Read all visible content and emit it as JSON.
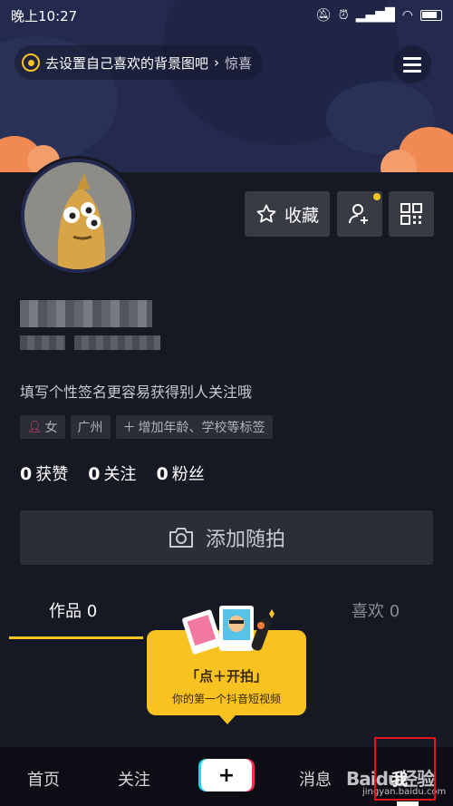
{
  "status_bar": {
    "time": "晚上10:27"
  },
  "header": {
    "background_prompt": "去设置自己喜欢的背景图吧",
    "prompt_trailing": "惊喜"
  },
  "profile": {
    "collect_label": "收藏",
    "bio": "填写个性签名更容易获得别人关注哦",
    "tags": {
      "gender": "女",
      "location": "广州",
      "add_more": "增加年龄、学校等标签"
    },
    "stats": {
      "likes_count": "0",
      "likes_label": "获赞",
      "following_count": "0",
      "following_label": "关注",
      "fans_count": "0",
      "fans_label": "粉丝"
    },
    "add_photo_label": "添加随拍"
  },
  "tabs": {
    "works": "作品 0",
    "likes": "喜欢 0"
  },
  "bubble": {
    "title": "「点＋开拍」",
    "subtitle": "你的第一个抖音短视频"
  },
  "bottom_nav": {
    "home": "首页",
    "follow": "关注",
    "create": "+",
    "messages": "消息",
    "me": "我"
  },
  "watermark": {
    "logo": "Baidu经验",
    "url": "jingyan.baidu.com"
  },
  "colors": {
    "accent": "#f8c220",
    "background": "#161823",
    "highlight": "#e0161f"
  }
}
